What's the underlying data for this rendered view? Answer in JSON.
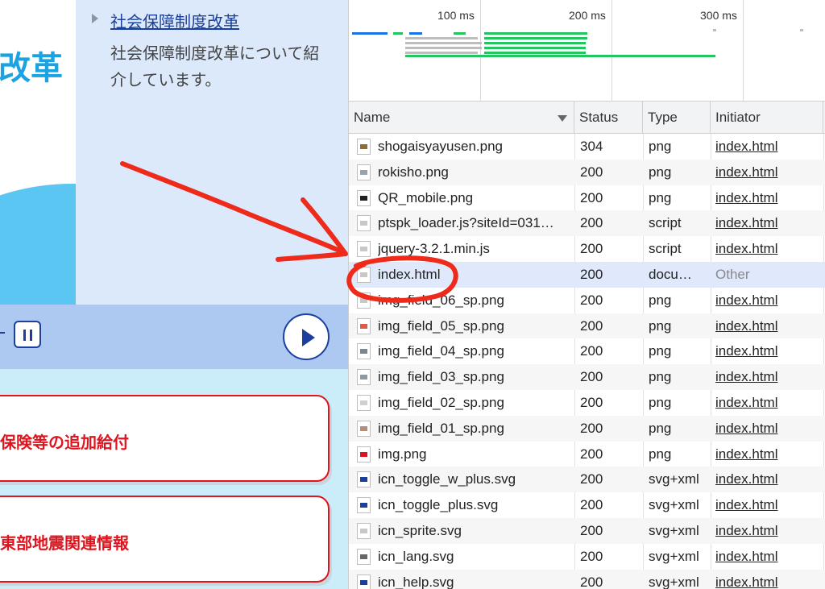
{
  "page": {
    "hero_title": "改革",
    "link_text": "社会保障制度改革",
    "description": "社会保障制度改革について紹介しています。",
    "cards": [
      "保険等の追加給付",
      "東部地震関連情報"
    ]
  },
  "overview": {
    "ticks": [
      "100 ms",
      "200 ms",
      "300 ms"
    ]
  },
  "network": {
    "columns": {
      "name": "Name",
      "status": "Status",
      "type": "Type",
      "initiator": "Initiator"
    },
    "rows": [
      {
        "name": "shogaisyayusen.png",
        "status": "304",
        "type": "png",
        "initiator": "index.html",
        "icon": "image-icon",
        "color": "#8a6d3b"
      },
      {
        "name": "rokisho.png",
        "status": "200",
        "type": "png",
        "initiator": "index.html",
        "icon": "image-icon",
        "color": "#9aa3ad"
      },
      {
        "name": "QR_mobile.png",
        "status": "200",
        "type": "png",
        "initiator": "index.html",
        "icon": "qr-image-icon",
        "color": "#222222"
      },
      {
        "name": "ptspk_loader.js?siteId=031…",
        "status": "200",
        "type": "script",
        "initiator": "index.html",
        "icon": "script-file-icon",
        "color": "#c8c8c8"
      },
      {
        "name": "jquery-3.2.1.min.js",
        "status": "200",
        "type": "script",
        "initiator": "index.html",
        "icon": "script-file-icon",
        "color": "#c8c8c8"
      },
      {
        "name": "index.html",
        "status": "200",
        "type": "docu…",
        "initiator": "Other",
        "icon": "document-icon",
        "color": "#c8c8c8"
      },
      {
        "name": "img_field_06_sp.png",
        "status": "200",
        "type": "png",
        "initiator": "index.html",
        "icon": "image-icon",
        "color": "#c8c8c8"
      },
      {
        "name": "img_field_05_sp.png",
        "status": "200",
        "type": "png",
        "initiator": "index.html",
        "icon": "image-icon",
        "color": "#e05a4b"
      },
      {
        "name": "img_field_04_sp.png",
        "status": "200",
        "type": "png",
        "initiator": "index.html",
        "icon": "image-icon",
        "color": "#7a8793"
      },
      {
        "name": "img_field_03_sp.png",
        "status": "200",
        "type": "png",
        "initiator": "index.html",
        "icon": "image-icon",
        "color": "#8d9aa6"
      },
      {
        "name": "img_field_02_sp.png",
        "status": "200",
        "type": "png",
        "initiator": "index.html",
        "icon": "image-icon",
        "color": "#d0d0d0"
      },
      {
        "name": "img_field_01_sp.png",
        "status": "200",
        "type": "png",
        "initiator": "index.html",
        "icon": "image-icon",
        "color": "#b88c7a"
      },
      {
        "name": "img.png",
        "status": "200",
        "type": "png",
        "initiator": "index.html",
        "icon": "image-icon",
        "color": "#e0141e"
      },
      {
        "name": "icn_toggle_w_plus.svg",
        "status": "200",
        "type": "svg+xml",
        "initiator": "index.html",
        "icon": "plus-icon",
        "color": "#1b3f9e"
      },
      {
        "name": "icn_toggle_plus.svg",
        "status": "200",
        "type": "svg+xml",
        "initiator": "index.html",
        "icon": "plus-circle-icon",
        "color": "#1b3f9e"
      },
      {
        "name": "icn_sprite.svg",
        "status": "200",
        "type": "svg+xml",
        "initiator": "index.html",
        "icon": "sprite-icon",
        "color": "#c8c8c8"
      },
      {
        "name": "icn_lang.svg",
        "status": "200",
        "type": "svg+xml",
        "initiator": "index.html",
        "icon": "triangle-icon",
        "color": "#666666"
      },
      {
        "name": "icn_help.svg",
        "status": "200",
        "type": "svg+xml",
        "initiator": "index.html",
        "icon": "help-icon",
        "color": "#1b3f9e"
      }
    ],
    "selected_row": "index.html"
  },
  "colors": {
    "annotation": "#ee2a1b",
    "link": "#1b3f9e",
    "alert": "#e0141e",
    "waterfall_green": "#22c55e",
    "waterfall_blue": "#1a73e8"
  }
}
